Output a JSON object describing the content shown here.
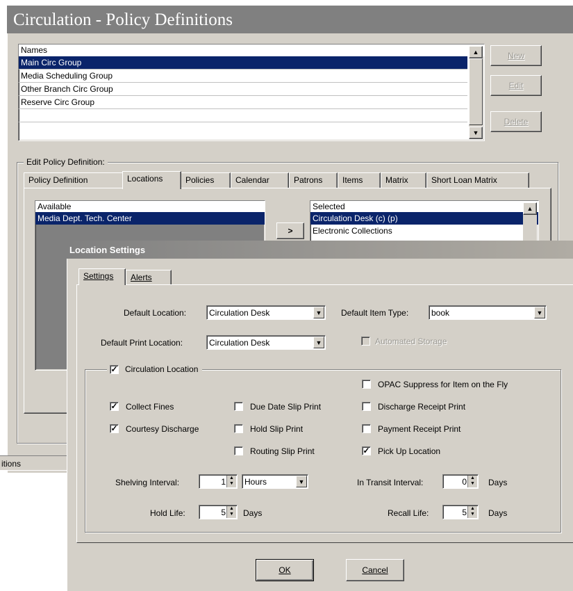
{
  "window": {
    "title": "Circulation - Policy Definitions",
    "status_text": "itions"
  },
  "names_list": {
    "header": "Names",
    "items": [
      "Main Circ Group",
      "Media Scheduling Group",
      "Other Branch Circ Group",
      "Reserve Circ Group",
      ""
    ],
    "selected_index": 0
  },
  "buttons": {
    "new": "New",
    "edit": "Edit",
    "delete": "Delete",
    "move_right": ">"
  },
  "edit_group": {
    "legend": "Edit  Policy Definition:",
    "tabs": [
      "Policy Definition",
      "Locations",
      "Policies",
      "Calendar",
      "Patrons",
      "Items",
      "Matrix",
      "Short Loan Matrix"
    ],
    "active_tab": "Locations"
  },
  "available": {
    "header": "Available",
    "items": [
      "Media Dept. Tech. Center"
    ]
  },
  "selected": {
    "header": "Selected",
    "items": [
      "Circulation Desk (c) (p)",
      "Electronic Collections"
    ]
  },
  "dialog": {
    "title": "Location Settings",
    "tabs": [
      "Settings",
      "Alerts"
    ],
    "active_tab": "Settings",
    "default_location_label": "Default Location:",
    "default_location_value": "Circulation Desk",
    "default_item_type_label": "Default Item Type:",
    "default_item_type_value": "book",
    "default_print_location_label": "Default Print Location:",
    "default_print_location_value": "Circulation Desk",
    "automated_storage_label": "Automated Storage",
    "circulation_location_label": "Circulation Location",
    "checkboxes": {
      "opac_suppress": {
        "label": "OPAC Suppress for Item on the Fly",
        "checked": false
      },
      "collect_fines": {
        "label": "Collect Fines",
        "checked": true
      },
      "due_date_slip": {
        "label": "Due Date Slip Print",
        "checked": false
      },
      "discharge_receipt": {
        "label": "Discharge Receipt Print",
        "checked": false
      },
      "courtesy_discharge": {
        "label": "Courtesy Discharge",
        "checked": true
      },
      "hold_slip": {
        "label": "Hold Slip Print",
        "checked": false
      },
      "payment_receipt": {
        "label": "Payment Receipt Print",
        "checked": false
      },
      "routing_slip": {
        "label": "Routing Slip Print",
        "checked": false
      },
      "pick_up_location": {
        "label": "Pick Up Location",
        "checked": true
      }
    },
    "shelving_interval_label": "Shelving Interval:",
    "shelving_interval_value": "1",
    "shelving_interval_unit": "Hours",
    "in_transit_label": "In Transit Interval:",
    "in_transit_value": "0",
    "in_transit_unit": "Days",
    "hold_life_label": "Hold Life:",
    "hold_life_value": "5",
    "hold_life_unit": "Days",
    "recall_life_label": "Recall Life:",
    "recall_life_value": "5",
    "recall_life_unit": "Days",
    "ok_label": "OK",
    "cancel_label": "Cancel"
  },
  "colors": {
    "face": "#d4d0c8",
    "title_bar": "#808080",
    "selection": "#0a246a"
  }
}
